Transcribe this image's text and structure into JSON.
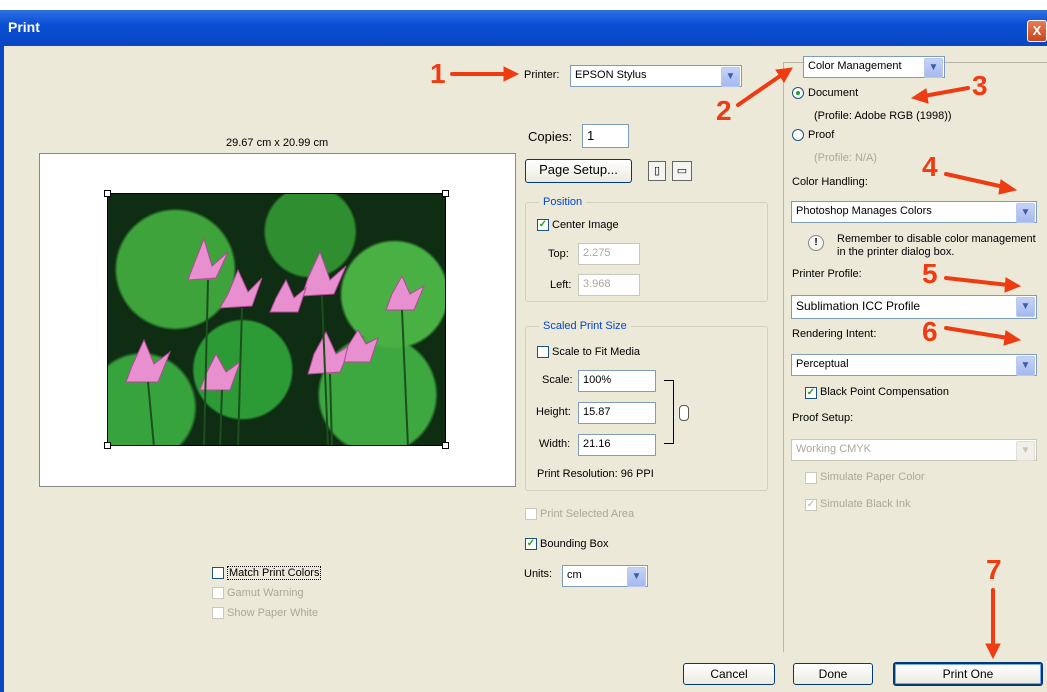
{
  "window": {
    "title": "Print",
    "close": "X"
  },
  "preview": {
    "size_label": "29.67 cm x 20.99 cm",
    "match_print_colors": "Match Print Colors",
    "gamut_warning": "Gamut Warning",
    "show_paper_white": "Show Paper White"
  },
  "printer": {
    "label": "Printer:",
    "value": "EPSON Stylus"
  },
  "copies": {
    "label": "Copies:",
    "value": "1"
  },
  "page_setup": "Page Setup...",
  "position": {
    "title": "Position",
    "center_image": "Center Image",
    "top_label": "Top:",
    "top_value": "2.275",
    "left_label": "Left:",
    "left_value": "3.968"
  },
  "scaled": {
    "title": "Scaled Print Size",
    "scale_to_fit": "Scale to Fit Media",
    "scale_label": "Scale:",
    "scale_value": "100%",
    "height_label": "Height:",
    "height_value": "15.87",
    "width_label": "Width:",
    "width_value": "21.16",
    "resolution": "Print Resolution: 96 PPI"
  },
  "print_selected_area": "Print Selected Area",
  "bounding_box": "Bounding Box",
  "units": {
    "label": "Units:",
    "value": "cm"
  },
  "color_mgmt": {
    "section": "Color Management",
    "document": "Document",
    "document_profile": "(Profile: Adobe RGB (1998))",
    "proof": "Proof",
    "proof_profile": "(Profile: N/A)",
    "color_handling_label": "Color Handling:",
    "color_handling_value": "Photoshop Manages Colors",
    "reminder": "Remember to disable color management in the printer dialog box.",
    "printer_profile_label": "Printer Profile:",
    "printer_profile_value": "Sublimation ICC Profile",
    "rendering_intent_label": "Rendering Intent:",
    "rendering_intent_value": "Perceptual",
    "black_point": "Black Point Compensation",
    "proof_setup_label": "Proof Setup:",
    "proof_setup_value": "Working CMYK",
    "simulate_paper": "Simulate Paper Color",
    "simulate_ink": "Simulate Black Ink"
  },
  "buttons": {
    "cancel": "Cancel",
    "done": "Done",
    "print_one": "Print One"
  },
  "annotations": [
    "1",
    "2",
    "3",
    "4",
    "5",
    "6",
    "7"
  ],
  "colors": {
    "title_bar": "#0846c4",
    "annotation": "#ee3b12",
    "check": "#21a121"
  }
}
